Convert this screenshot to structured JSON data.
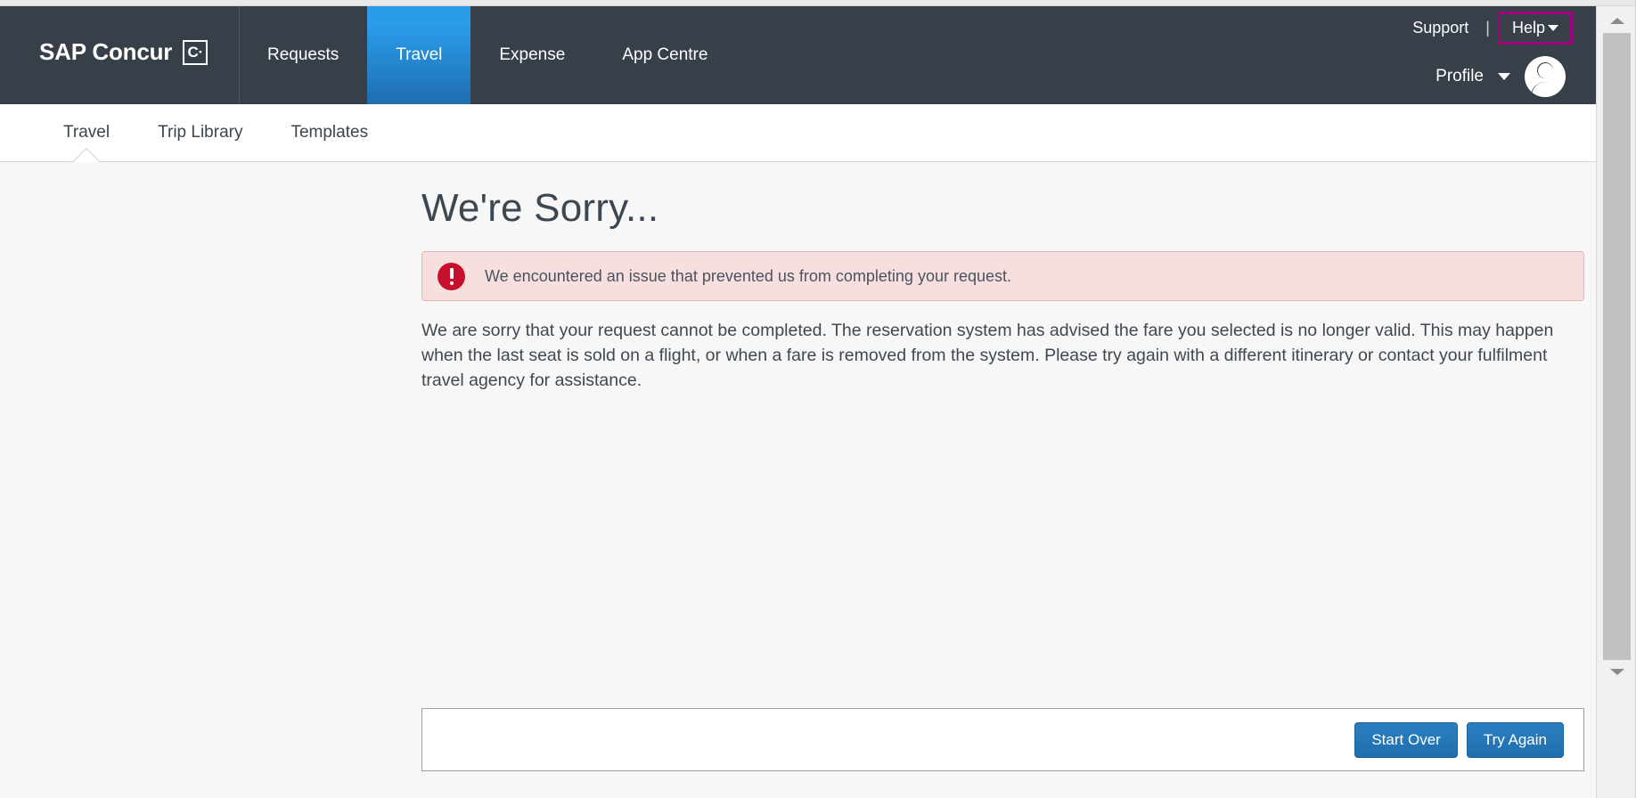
{
  "app": {
    "brand_name": "SAP Concur",
    "brand_mark": "C·"
  },
  "topnav": {
    "items": [
      {
        "label": "Requests",
        "active": false
      },
      {
        "label": "Travel",
        "active": true
      },
      {
        "label": "Expense",
        "active": false
      },
      {
        "label": "App Centre",
        "active": false
      }
    ],
    "utility": {
      "support_label": "Support",
      "separator": "|",
      "help_label": "Help",
      "help_highlight_color": "#a3007d",
      "profile_label": "Profile",
      "avatar_icon": "user-avatar-icon"
    },
    "background_color": "#373f49",
    "active_tab_color": "#2a9ce9"
  },
  "subnav": {
    "tabs": [
      {
        "label": "Travel",
        "active": true
      },
      {
        "label": "Trip Library",
        "active": false
      },
      {
        "label": "Templates",
        "active": false
      }
    ]
  },
  "main": {
    "page_title": "We're Sorry...",
    "alert": {
      "icon": "error-exclamation-icon",
      "message": "We encountered an issue that prevented us from completing your request.",
      "background_color": "#f7dedf",
      "border_color": "#e0b6b8",
      "icon_color": "#c8102e"
    },
    "body_text": "We are sorry that your request cannot be completed. The reservation system has advised the fare you selected is no longer valid. This may happen when the last seat is sold on a flight, or when a fare is removed from the system. Please try again with a different itinerary or contact your fulfilment travel agency for assistance."
  },
  "footer": {
    "start_over_label": "Start Over",
    "try_again_label": "Try Again",
    "button_color": "#1f6fb0"
  },
  "scrollbar": {
    "up_icon": "scroll-up-arrow-icon",
    "down_icon": "scroll-down-arrow-icon"
  }
}
